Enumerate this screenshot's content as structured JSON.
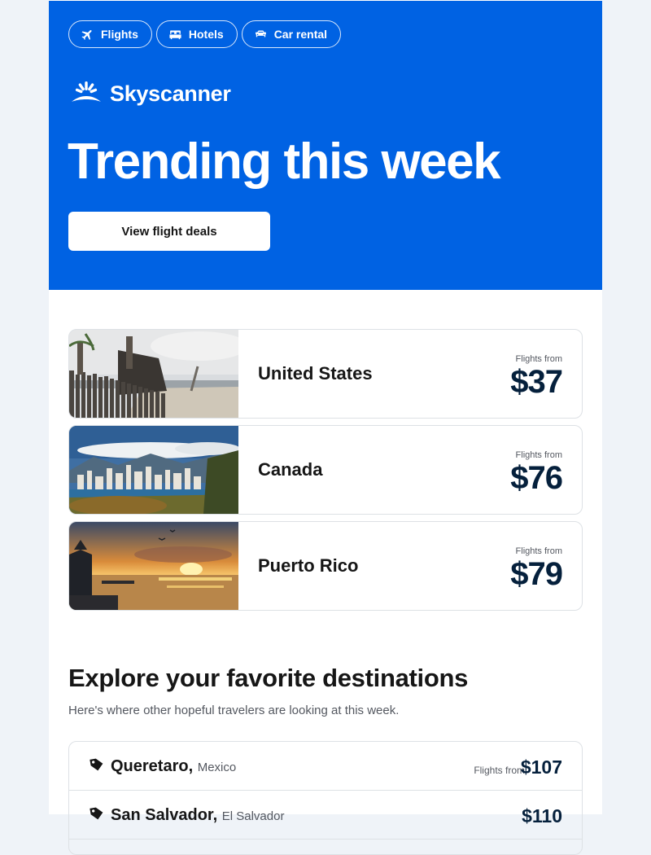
{
  "header": {
    "tabs": [
      {
        "label": "Flights",
        "icon": "plane-icon"
      },
      {
        "label": "Hotels",
        "icon": "bed-icon"
      },
      {
        "label": "Car rental",
        "icon": "car-icon"
      }
    ],
    "logo_text": "Skyscanner",
    "title": "Trending this week",
    "cta_label": "View flight deals"
  },
  "trending": [
    {
      "name": "United States",
      "from_label": "Flights from",
      "price": "$37"
    },
    {
      "name": "Canada",
      "from_label": "Flights from",
      "price": "$76"
    },
    {
      "name": "Puerto Rico",
      "from_label": "Flights from",
      "price": "$79"
    }
  ],
  "explore": {
    "title": "Explore your favorite destinations",
    "subtitle": "Here's where other hopeful travelers are looking at this week.",
    "destinations": [
      {
        "city": "Queretaro,",
        "country": "Mexico",
        "from_label": "Flights from",
        "price": "$107"
      },
      {
        "city": "San Salvador,",
        "country": "El Salvador",
        "from_label": "",
        "price": "$110"
      }
    ]
  },
  "colors": {
    "brand_blue": "#0062e3",
    "price_navy": "#05203c",
    "page_bg": "#eff3f8"
  }
}
